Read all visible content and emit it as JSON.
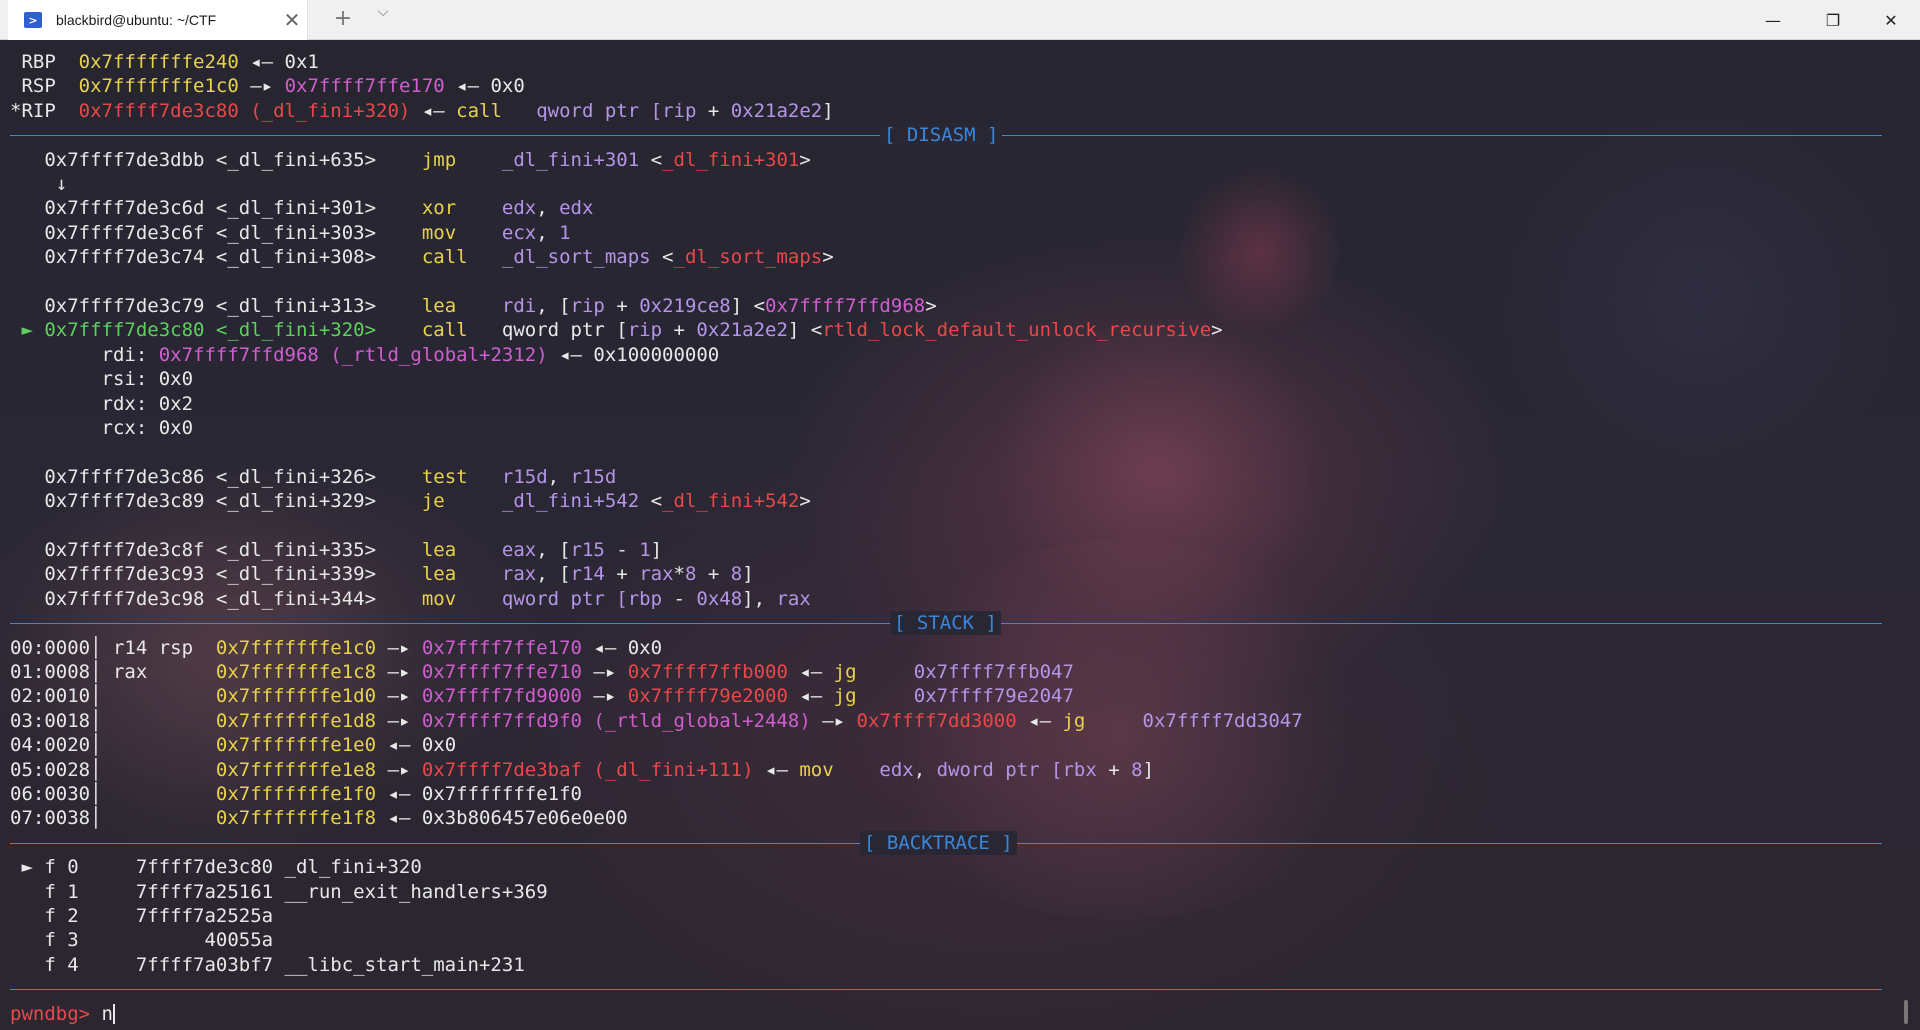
{
  "window": {
    "tab_title": "blackbird@ubuntu: ~/CTF",
    "tab_icon": "terminal-icon",
    "new_tab": "+",
    "dropdown": "⌵",
    "close": "✕",
    "minimize": "—",
    "maximize": "❐",
    "window_close": "✕"
  },
  "colors": {
    "address_yellow": "#e8d24a",
    "pointer_magenta": "#d05ed0",
    "code_red": "#e84848",
    "current_green": "#5ed05e",
    "separator_blue": "#3a86d8",
    "instr_purple": "#b495e8"
  },
  "registers": [
    {
      "name": "RBP",
      "segments": [
        {
          "t": " RBP  ",
          "c": "w"
        },
        {
          "t": "0x7fffffffe240",
          "c": "y"
        },
        {
          "t": " ◂— 0x1",
          "c": "w"
        }
      ]
    },
    {
      "name": "RSP",
      "segments": [
        {
          "t": " RSP  ",
          "c": "w"
        },
        {
          "t": "0x7fffffffe1c0",
          "c": "y"
        },
        {
          "t": " —▸ ",
          "c": "w"
        },
        {
          "t": "0x7ffff7ffe170",
          "c": "m"
        },
        {
          "t": " ◂— 0x0",
          "c": "w"
        }
      ]
    },
    {
      "name": "RIP",
      "segments": [
        {
          "t": "*RIP  ",
          "c": "w"
        },
        {
          "t": "0x7ffff7de3c80 (_dl_fini+320)",
          "c": "r"
        },
        {
          "t": " ◂— ",
          "c": "w"
        },
        {
          "t": "call",
          "c": "y"
        },
        {
          "t": "   qword ptr [",
          "c": "p"
        },
        {
          "t": "rip",
          "c": "p"
        },
        {
          "t": " + ",
          "c": "w"
        },
        {
          "t": "0x21a2e2",
          "c": "p"
        },
        {
          "t": "]",
          "c": "w"
        }
      ]
    }
  ],
  "sections": {
    "disasm": "[ DISASM ]",
    "stack": "[ STACK ]",
    "backtrace": "[ BACKTRACE ]"
  },
  "disasm": [
    {
      "segments": [
        {
          "t": "   0x7ffff7de3dbb <_dl_fini+635>    ",
          "c": "w"
        },
        {
          "t": "jmp",
          "c": "y"
        },
        {
          "t": "    _dl_fini+301",
          "c": "p"
        },
        {
          "t": " <",
          "c": "w"
        },
        {
          "t": "_dl_fini+301",
          "c": "r"
        },
        {
          "t": ">",
          "c": "w"
        }
      ]
    },
    {
      "segments": [
        {
          "t": "    ↓",
          "c": "w"
        }
      ]
    },
    {
      "segments": [
        {
          "t": "   0x7ffff7de3c6d <_dl_fini+301>    ",
          "c": "w"
        },
        {
          "t": "xor",
          "c": "y"
        },
        {
          "t": "    edx",
          "c": "p"
        },
        {
          "t": ", ",
          "c": "w"
        },
        {
          "t": "edx",
          "c": "p"
        }
      ]
    },
    {
      "segments": [
        {
          "t": "   0x7ffff7de3c6f <_dl_fini+303>    ",
          "c": "w"
        },
        {
          "t": "mov",
          "c": "y"
        },
        {
          "t": "    ecx",
          "c": "p"
        },
        {
          "t": ", ",
          "c": "w"
        },
        {
          "t": "1",
          "c": "p"
        }
      ]
    },
    {
      "segments": [
        {
          "t": "   0x7ffff7de3c74 <_dl_fini+308>    ",
          "c": "w"
        },
        {
          "t": "call",
          "c": "y"
        },
        {
          "t": "   _dl_sort_maps",
          "c": "p"
        },
        {
          "t": " <",
          "c": "w"
        },
        {
          "t": "_dl_sort_maps",
          "c": "r"
        },
        {
          "t": ">",
          "c": "w"
        }
      ]
    },
    {
      "segments": [
        {
          "t": " ",
          "c": "w"
        }
      ]
    },
    {
      "segments": [
        {
          "t": "   0x7ffff7de3c79 <_dl_fini+313>    ",
          "c": "w"
        },
        {
          "t": "lea",
          "c": "y"
        },
        {
          "t": "    rdi",
          "c": "p"
        },
        {
          "t": ", [",
          "c": "w"
        },
        {
          "t": "rip",
          "c": "p"
        },
        {
          "t": " + ",
          "c": "w"
        },
        {
          "t": "0x219ce8",
          "c": "p"
        },
        {
          "t": "] <",
          "c": "w"
        },
        {
          "t": "0x7ffff7ffd968",
          "c": "m"
        },
        {
          "t": ">",
          "c": "w"
        }
      ]
    },
    {
      "segments": [
        {
          "t": " ► 0x7ffff7de3c80 <_dl_fini+320>    ",
          "c": "g"
        },
        {
          "t": "call",
          "c": "y"
        },
        {
          "t": "   qword ptr [",
          "c": "w"
        },
        {
          "t": "rip",
          "c": "p"
        },
        {
          "t": " + ",
          "c": "w"
        },
        {
          "t": "0x21a2e2",
          "c": "p"
        },
        {
          "t": "] <",
          "c": "w"
        },
        {
          "t": "rtld_lock_default_unlock_recursive",
          "c": "r"
        },
        {
          "t": ">",
          "c": "w"
        }
      ]
    },
    {
      "segments": [
        {
          "t": "        rdi: ",
          "c": "w"
        },
        {
          "t": "0x7ffff7ffd968 (_rtld_global+2312)",
          "c": "m"
        },
        {
          "t": " ◂— 0x100000000",
          "c": "w"
        }
      ]
    },
    {
      "segments": [
        {
          "t": "        rsi: 0x0",
          "c": "w"
        }
      ]
    },
    {
      "segments": [
        {
          "t": "        rdx: 0x2",
          "c": "w"
        }
      ]
    },
    {
      "segments": [
        {
          "t": "        rcx: 0x0",
          "c": "w"
        }
      ]
    },
    {
      "segments": [
        {
          "t": " ",
          "c": "w"
        }
      ]
    },
    {
      "segments": [
        {
          "t": "   0x7ffff7de3c86 <_dl_fini+326>    ",
          "c": "w"
        },
        {
          "t": "test",
          "c": "y"
        },
        {
          "t": "   r15d",
          "c": "p"
        },
        {
          "t": ", ",
          "c": "w"
        },
        {
          "t": "r15d",
          "c": "p"
        }
      ]
    },
    {
      "segments": [
        {
          "t": "   0x7ffff7de3c89 <_dl_fini+329>    ",
          "c": "w"
        },
        {
          "t": "je",
          "c": "y"
        },
        {
          "t": "     _dl_fini+542",
          "c": "p"
        },
        {
          "t": " <",
          "c": "w"
        },
        {
          "t": "_dl_fini+542",
          "c": "r"
        },
        {
          "t": ">",
          "c": "w"
        }
      ]
    },
    {
      "segments": [
        {
          "t": " ",
          "c": "w"
        }
      ]
    },
    {
      "segments": [
        {
          "t": "   0x7ffff7de3c8f <_dl_fini+335>    ",
          "c": "w"
        },
        {
          "t": "lea",
          "c": "y"
        },
        {
          "t": "    eax",
          "c": "p"
        },
        {
          "t": ", [",
          "c": "w"
        },
        {
          "t": "r15",
          "c": "p"
        },
        {
          "t": " - ",
          "c": "w"
        },
        {
          "t": "1",
          "c": "p"
        },
        {
          "t": "]",
          "c": "w"
        }
      ]
    },
    {
      "segments": [
        {
          "t": "   0x7ffff7de3c93 <_dl_fini+339>    ",
          "c": "w"
        },
        {
          "t": "lea",
          "c": "y"
        },
        {
          "t": "    rax",
          "c": "p"
        },
        {
          "t": ", [",
          "c": "w"
        },
        {
          "t": "r14",
          "c": "p"
        },
        {
          "t": " + ",
          "c": "w"
        },
        {
          "t": "rax",
          "c": "p"
        },
        {
          "t": "*",
          "c": "w"
        },
        {
          "t": "8",
          "c": "p"
        },
        {
          "t": " + ",
          "c": "w"
        },
        {
          "t": "8",
          "c": "p"
        },
        {
          "t": "]",
          "c": "w"
        }
      ]
    },
    {
      "segments": [
        {
          "t": "   0x7ffff7de3c98 <_dl_fini+344>    ",
          "c": "w"
        },
        {
          "t": "mov",
          "c": "y"
        },
        {
          "t": "    qword ptr [",
          "c": "p"
        },
        {
          "t": "rbp",
          "c": "p"
        },
        {
          "t": " - ",
          "c": "w"
        },
        {
          "t": "0x48",
          "c": "p"
        },
        {
          "t": "], ",
          "c": "w"
        },
        {
          "t": "rax",
          "c": "p"
        }
      ]
    }
  ],
  "stack": [
    {
      "segments": [
        {
          "t": "00:0000│ r14 rsp  ",
          "c": "w"
        },
        {
          "t": "0x7fffffffe1c0",
          "c": "y"
        },
        {
          "t": " —▸ ",
          "c": "w"
        },
        {
          "t": "0x7ffff7ffe170",
          "c": "m"
        },
        {
          "t": " ◂— 0x0",
          "c": "w"
        }
      ]
    },
    {
      "segments": [
        {
          "t": "01:0008│ rax      ",
          "c": "w"
        },
        {
          "t": "0x7fffffffe1c8",
          "c": "y"
        },
        {
          "t": " —▸ ",
          "c": "w"
        },
        {
          "t": "0x7ffff7ffe710",
          "c": "m"
        },
        {
          "t": " —▸ ",
          "c": "w"
        },
        {
          "t": "0x7ffff7ffb000",
          "c": "r"
        },
        {
          "t": " ◂— ",
          "c": "w"
        },
        {
          "t": "jg",
          "c": "y"
        },
        {
          "t": "     0x7ffff7ffb047",
          "c": "p"
        }
      ]
    },
    {
      "segments": [
        {
          "t": "02:0010│          ",
          "c": "w"
        },
        {
          "t": "0x7fffffffe1d0",
          "c": "y"
        },
        {
          "t": " —▸ ",
          "c": "w"
        },
        {
          "t": "0x7ffff7fd9000",
          "c": "m"
        },
        {
          "t": " —▸ ",
          "c": "w"
        },
        {
          "t": "0x7ffff79e2000",
          "c": "r"
        },
        {
          "t": " ◂— ",
          "c": "w"
        },
        {
          "t": "jg",
          "c": "y"
        },
        {
          "t": "     0x7ffff79e2047",
          "c": "p"
        }
      ]
    },
    {
      "segments": [
        {
          "t": "03:0018│          ",
          "c": "w"
        },
        {
          "t": "0x7fffffffe1d8",
          "c": "y"
        },
        {
          "t": " —▸ ",
          "c": "w"
        },
        {
          "t": "0x7ffff7ffd9f0 (_rtld_global+2448)",
          "c": "m"
        },
        {
          "t": " —▸ ",
          "c": "w"
        },
        {
          "t": "0x7ffff7dd3000",
          "c": "r"
        },
        {
          "t": " ◂— ",
          "c": "w"
        },
        {
          "t": "jg",
          "c": "y"
        },
        {
          "t": "     0x7ffff7dd3047",
          "c": "p"
        }
      ]
    },
    {
      "segments": [
        {
          "t": "04:0020│          ",
          "c": "w"
        },
        {
          "t": "0x7fffffffe1e0",
          "c": "y"
        },
        {
          "t": " ◂— 0x0",
          "c": "w"
        }
      ]
    },
    {
      "segments": [
        {
          "t": "05:0028│          ",
          "c": "w"
        },
        {
          "t": "0x7fffffffe1e8",
          "c": "y"
        },
        {
          "t": " —▸ ",
          "c": "w"
        },
        {
          "t": "0x7ffff7de3baf (_dl_fini+111)",
          "c": "r"
        },
        {
          "t": " ◂— ",
          "c": "w"
        },
        {
          "t": "mov",
          "c": "y"
        },
        {
          "t": "    edx",
          "c": "p"
        },
        {
          "t": ", ",
          "c": "w"
        },
        {
          "t": "dword ptr [",
          "c": "p"
        },
        {
          "t": "rbx",
          "c": "p"
        },
        {
          "t": " + ",
          "c": "w"
        },
        {
          "t": "8",
          "c": "p"
        },
        {
          "t": "]",
          "c": "w"
        }
      ]
    },
    {
      "segments": [
        {
          "t": "06:0030│          ",
          "c": "w"
        },
        {
          "t": "0x7fffffffe1f0",
          "c": "y"
        },
        {
          "t": " ◂— 0x7fffffffe1f0",
          "c": "w"
        }
      ]
    },
    {
      "segments": [
        {
          "t": "07:0038│          ",
          "c": "w"
        },
        {
          "t": "0x7fffffffe1f8",
          "c": "y"
        },
        {
          "t": " ◂— 0x3b806457e06e0e00",
          "c": "w"
        }
      ]
    }
  ],
  "backtrace": [
    {
      "segments": [
        {
          "t": " ► f 0     7ffff7de3c80 _dl_fini+320",
          "c": "w"
        }
      ]
    },
    {
      "segments": [
        {
          "t": "   f 1     7ffff7a25161 __run_exit_handlers+369",
          "c": "w"
        }
      ]
    },
    {
      "segments": [
        {
          "t": "   f 2     7ffff7a2525a",
          "c": "w"
        }
      ]
    },
    {
      "segments": [
        {
          "t": "   f 3           40055a",
          "c": "w"
        }
      ]
    },
    {
      "segments": [
        {
          "t": "   f 4     7ffff7a03bf7 __libc_start_main+231",
          "c": "w"
        }
      ]
    }
  ],
  "prompt": {
    "label": "pwndbg> ",
    "input": "n"
  }
}
